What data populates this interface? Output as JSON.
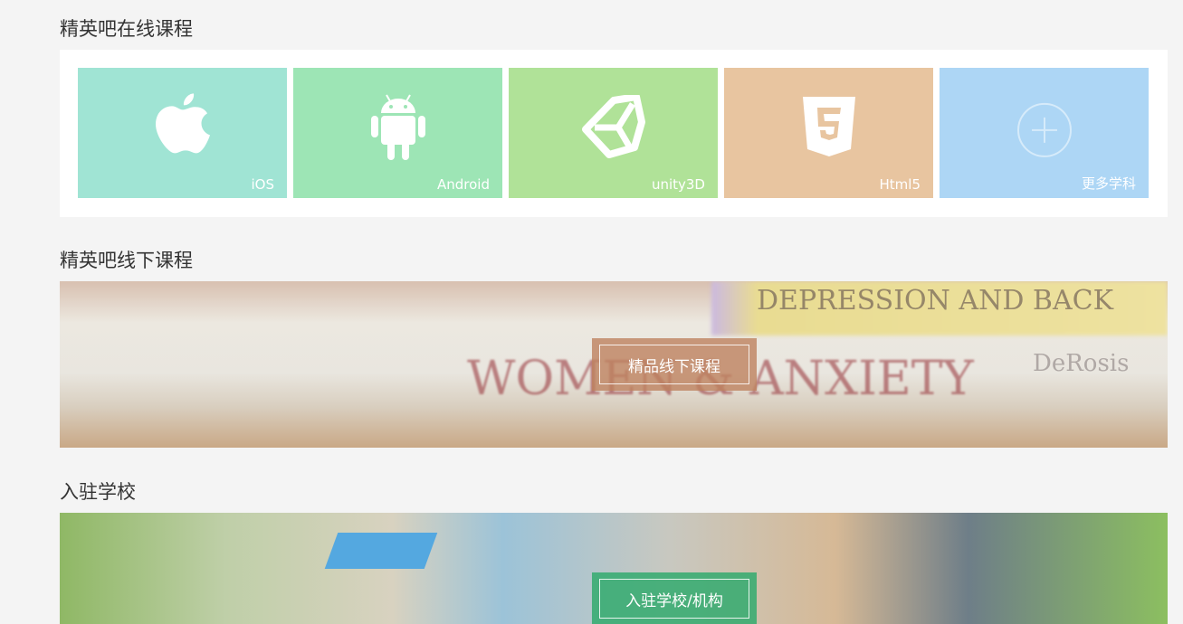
{
  "online": {
    "title": "精英吧在线课程",
    "tiles": [
      {
        "label": "iOS",
        "color": "#a0e4d4",
        "icon": "apple-icon"
      },
      {
        "label": "Android",
        "color": "#9de5b5",
        "icon": "android-icon"
      },
      {
        "label": "unity3D",
        "color": "#b0e298",
        "icon": "unity-icon"
      },
      {
        "label": "Html5",
        "color": "#e8c5a0",
        "icon": "html5-icon"
      },
      {
        "label": "更多学科",
        "color": "#add6f5",
        "icon": "plus-circle-icon"
      }
    ]
  },
  "offline": {
    "title": "精英吧线下课程",
    "button": "精品线下课程",
    "book_top": "DEPRESSION AND BACK",
    "book_main": "WOMEN & ANXIETY",
    "book_author": "DeRosis"
  },
  "school": {
    "title": "入驻学校",
    "button": "入驻学校/机构"
  }
}
